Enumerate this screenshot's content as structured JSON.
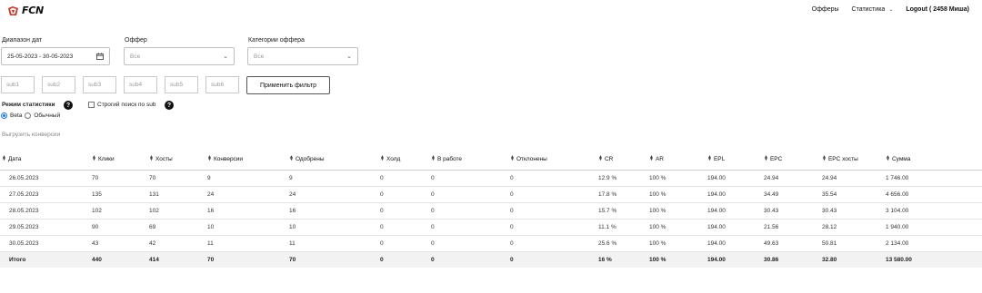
{
  "header": {
    "logo_text": "FCN",
    "nav": {
      "offers": "Офферы",
      "stats": "Статистика",
      "logout": "Logout ( 2458 Миша)"
    }
  },
  "filters": {
    "date_range": {
      "label": "Диапазон дат",
      "value": "25-05-2023 - 30-05-2023"
    },
    "offer": {
      "label": "Оффер",
      "value": "Все"
    },
    "offer_category": {
      "label": "Категории оффера",
      "value": "Все"
    },
    "subs": [
      "sub1",
      "sub2",
      "sub3",
      "sub4",
      "sub5",
      "sub6"
    ],
    "apply_label": "Применить фильтр"
  },
  "mode": {
    "label": "Режим статистики",
    "strict_label": "Строгий поиск по sub",
    "options": [
      "Beta",
      "Обычный"
    ],
    "selected": "Beta"
  },
  "export_label": "Выгрузить конверсии",
  "table": {
    "columns": [
      "Дата",
      "Клики",
      "Хосты",
      "Конверсии",
      "Одобрены",
      "Холд",
      "В работе",
      "Отклонены",
      "CR",
      "AR",
      "EPL",
      "EPC",
      "EPC хосты",
      "Сумма"
    ],
    "rows": [
      [
        "26.05.2023",
        "70",
        "70",
        "9",
        "9",
        "0",
        "0",
        "0",
        "12.9 %",
        "100 %",
        "194.00",
        "24.94",
        "24.94",
        "1 746.00"
      ],
      [
        "27.05.2023",
        "135",
        "131",
        "24",
        "24",
        "0",
        "0",
        "0",
        "17.8 %",
        "100 %",
        "194.00",
        "34.49",
        "35.54",
        "4 656.00"
      ],
      [
        "28.05.2023",
        "102",
        "102",
        "16",
        "16",
        "0",
        "0",
        "0",
        "15.7 %",
        "100 %",
        "194.00",
        "30.43",
        "30.43",
        "3 104.00"
      ],
      [
        "29.05.2023",
        "90",
        "69",
        "10",
        "10",
        "0",
        "0",
        "0",
        "11.1 %",
        "100 %",
        "194.00",
        "21.56",
        "28.12",
        "1 940.00"
      ],
      [
        "30.05.2023",
        "43",
        "42",
        "11",
        "11",
        "0",
        "0",
        "0",
        "25.6 %",
        "100 %",
        "194.00",
        "49.63",
        "50.81",
        "2 134.00"
      ]
    ],
    "total": [
      "Итого",
      "440",
      "414",
      "70",
      "70",
      "0",
      "0",
      "0",
      "16 %",
      "100 %",
      "194.00",
      "30.86",
      "32.80",
      "13 580.00"
    ]
  }
}
